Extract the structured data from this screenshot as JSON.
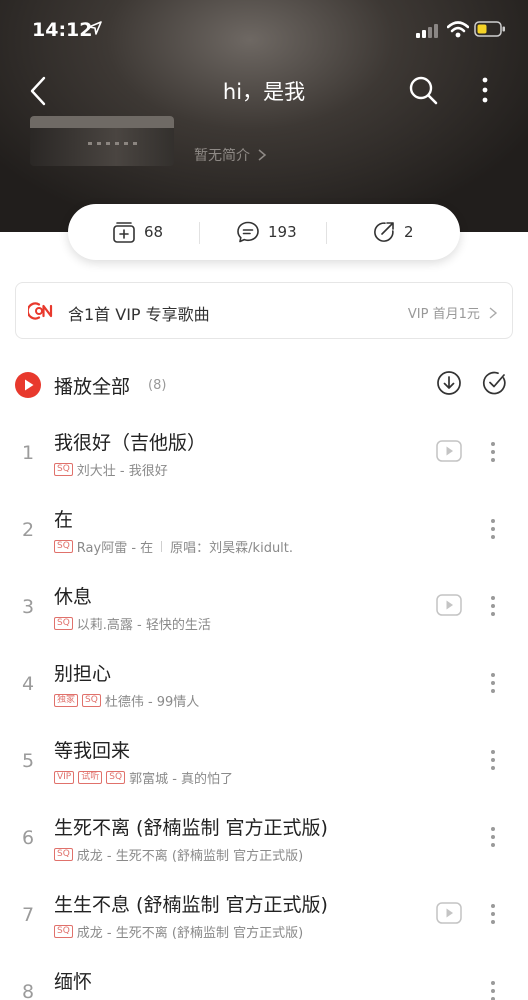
{
  "status_bar": {
    "time": "14:12"
  },
  "nav": {
    "title": "hi，是我"
  },
  "playlist": {
    "intro": "暂无简介",
    "stats": {
      "collect_count": "68",
      "comment_count": "193",
      "share_count": "2"
    }
  },
  "vip_banner": {
    "text": "含1首 VIP 专享歌曲",
    "promo": "VIP 首月1元"
  },
  "play_all": {
    "label": "播放全部",
    "count": "(8)"
  },
  "songs": [
    {
      "index": "1",
      "title": "我很好（吉他版）",
      "tags": [
        "SQ"
      ],
      "subtitle": "刘大壮 - 我很好",
      "original": "",
      "has_mv": true
    },
    {
      "index": "2",
      "title": "在",
      "tags": [
        "SQ"
      ],
      "subtitle": "Ray阿雷 - 在",
      "original": "原唱：刘昊霖/kidult.",
      "has_mv": false
    },
    {
      "index": "3",
      "title": "休息",
      "tags": [
        "SQ"
      ],
      "subtitle": "以莉.高露 - 轻快的生活",
      "original": "",
      "has_mv": true
    },
    {
      "index": "4",
      "title": "别担心",
      "tags": [
        "独家",
        "SQ"
      ],
      "subtitle": "杜德伟 - 99情人",
      "original": "",
      "has_mv": false
    },
    {
      "index": "5",
      "title": "等我回来",
      "tags": [
        "VIP",
        "试听",
        "SQ"
      ],
      "subtitle": "郭富城 - 真的怕了",
      "original": "",
      "has_mv": false
    },
    {
      "index": "6",
      "title": "生死不离 (舒楠监制 官方正式版)",
      "tags": [
        "SQ"
      ],
      "subtitle": "成龙 - 生死不离 (舒楠监制 官方正式版)",
      "original": "",
      "has_mv": false
    },
    {
      "index": "7",
      "title": "生生不息 (舒楠监制 官方正式版)",
      "tags": [
        "SQ"
      ],
      "subtitle": "成龙 - 生死不离 (舒楠监制 官方正式版)",
      "original": "",
      "has_mv": true
    },
    {
      "index": "8",
      "title": "缅怀",
      "tags": [],
      "subtitle": "",
      "original": "",
      "has_mv": false
    }
  ],
  "colors": {
    "accent_red": "#e8392d",
    "tag_red": "#e0716b",
    "header_dark": "#2a2624"
  },
  "icons": {
    "back": "back-arrow-icon",
    "search": "search-icon",
    "more": "more-vertical-icon",
    "collect": "add-collection-icon",
    "comment": "comment-icon",
    "share": "share-icon",
    "vip": "vip-logo-icon",
    "play": "play-circle-icon",
    "download": "download-icon",
    "multiselect": "check-circle-icon",
    "mv": "mv-play-icon"
  }
}
